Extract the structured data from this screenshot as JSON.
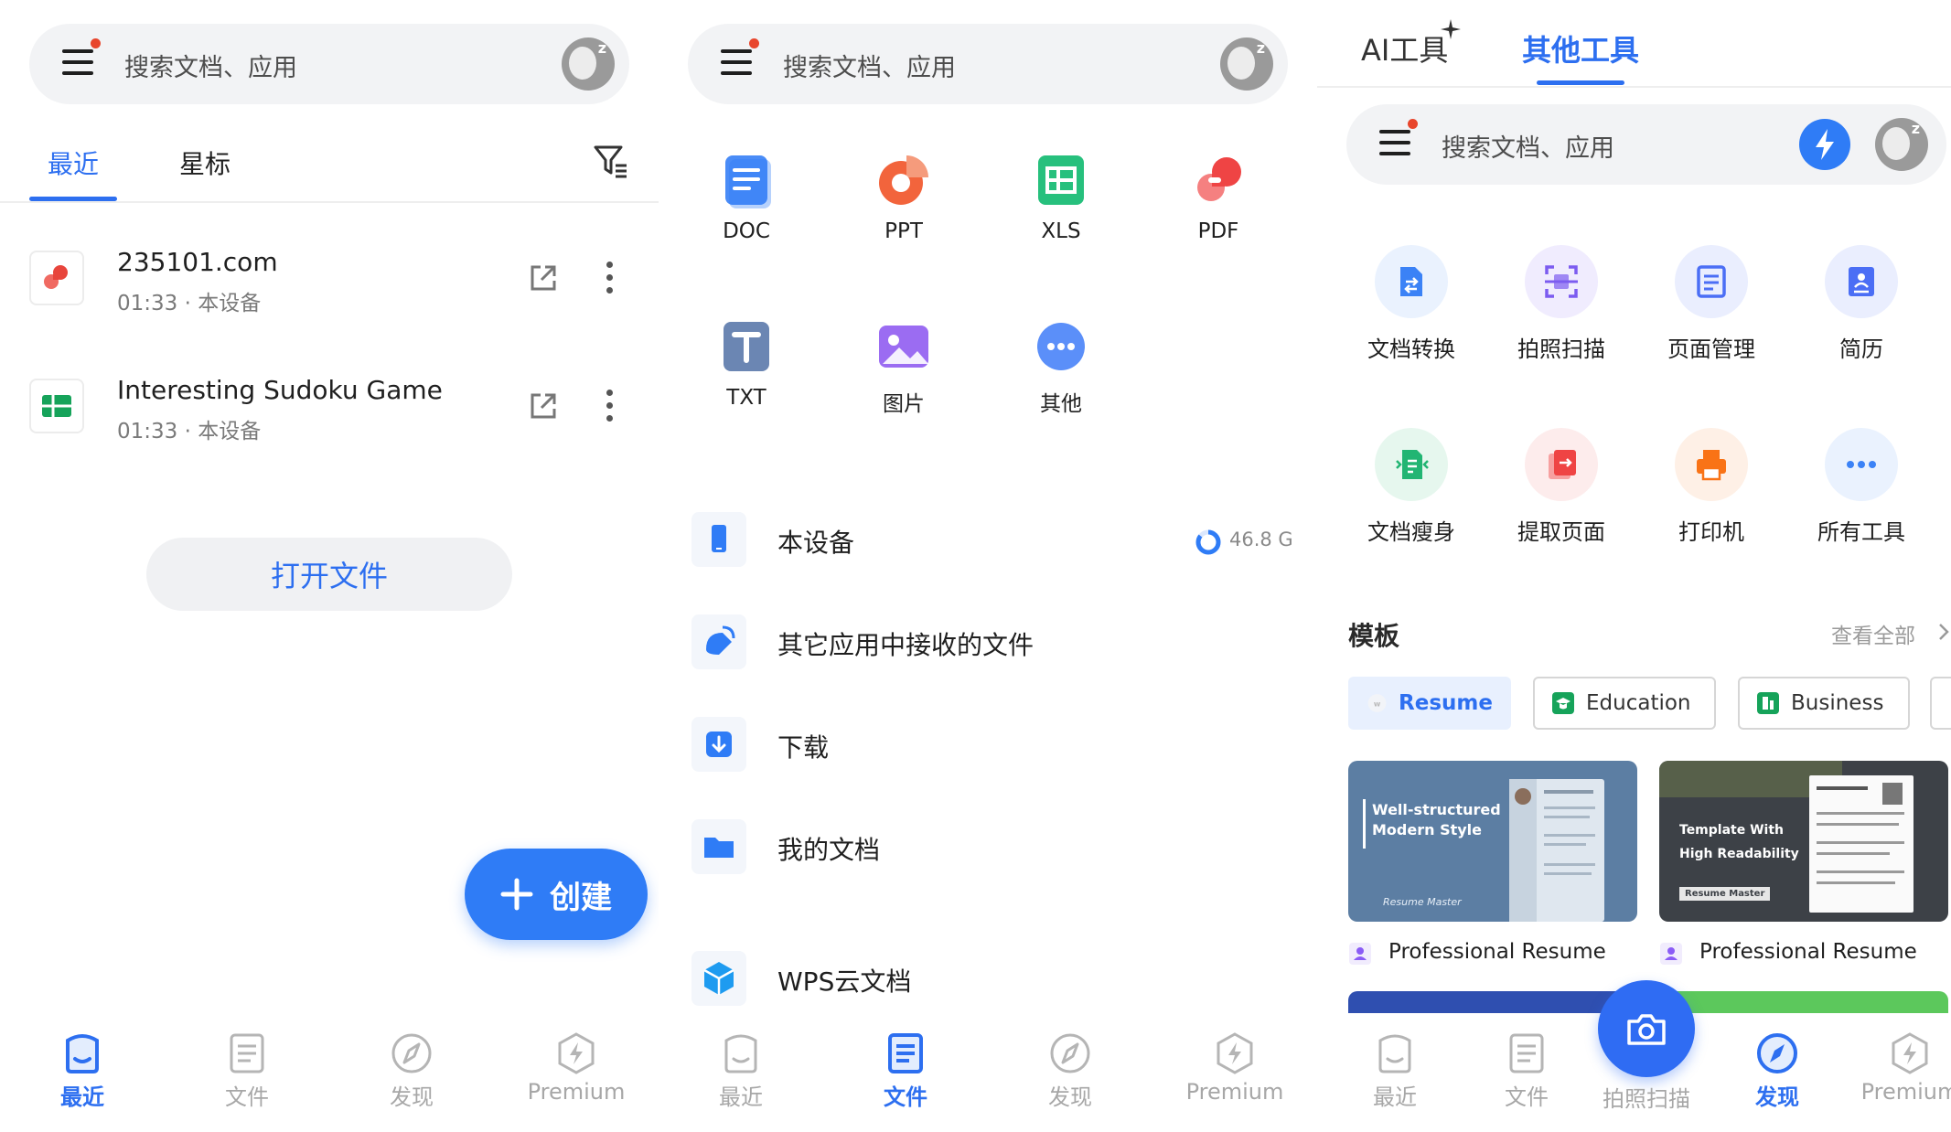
{
  "colors": {
    "accent": "#2d6ff0",
    "fab": "#2f7cf6",
    "notify_dot": "#e8452c",
    "inactive": "#a7a7a7"
  },
  "search": {
    "placeholder": "搜索文档、应用"
  },
  "bottom_nav": {
    "recent": "最近",
    "files": "文件",
    "discover": "发现",
    "premium": "Premium",
    "scan": "拍照扫描"
  },
  "recent_screen": {
    "tabs": {
      "recent": "最近",
      "starred": "星标"
    },
    "files": [
      {
        "name": "235101.com",
        "meta": "01:33 · 本设备",
        "icon": "pdf-icon"
      },
      {
        "name": "Interesting Sudoku Game",
        "meta": "01:33 · 本设备",
        "icon": "xls-icon"
      }
    ],
    "open_file_label": "打开文件",
    "create_label": "创建"
  },
  "files_screen": {
    "types": [
      {
        "label": "DOC",
        "icon": "doc-icon"
      },
      {
        "label": "PPT",
        "icon": "ppt-icon"
      },
      {
        "label": "XLS",
        "icon": "xls-icon"
      },
      {
        "label": "PDF",
        "icon": "pdf-icon"
      },
      {
        "label": "TXT",
        "icon": "txt-icon"
      },
      {
        "label": "图片",
        "icon": "image-icon"
      },
      {
        "label": "其他",
        "icon": "more-icon"
      }
    ],
    "locations": [
      {
        "label": "本设备",
        "icon": "phone-icon"
      },
      {
        "label": "其它应用中接收的文件",
        "icon": "received-icon"
      },
      {
        "label": "下载",
        "icon": "download-icon"
      },
      {
        "label": "我的文档",
        "icon": "folder-icon"
      },
      {
        "label": "WPS云文档",
        "icon": "cloud-cube-icon"
      }
    ],
    "storage_label": "46.8 G",
    "storage_used_fraction": 0.85
  },
  "discover_screen": {
    "tabs": {
      "ai_tools": "AI工具",
      "other_tools": "其他工具"
    },
    "tools": [
      {
        "label": "文档转换",
        "icon": "convert-icon",
        "color": "#3b82f6"
      },
      {
        "label": "拍照扫描",
        "icon": "scan-icon",
        "color": "#7c5cf0"
      },
      {
        "label": "页面管理",
        "icon": "page-manage-icon",
        "color": "#4b6ef5"
      },
      {
        "label": "简历",
        "icon": "resume-icon",
        "color": "#4b6ef5"
      },
      {
        "label": "文档瘦身",
        "icon": "slim-icon",
        "color": "#22b573"
      },
      {
        "label": "提取页面",
        "icon": "extract-icon",
        "color": "#ef4444"
      },
      {
        "label": "打印机",
        "icon": "printer-icon",
        "color": "#f97316"
      },
      {
        "label": "所有工具",
        "icon": "more-icon",
        "color": "#3b82f6"
      }
    ],
    "templates_title": "模板",
    "see_all": "查看全部",
    "chips": [
      {
        "label": "Resume",
        "active": true
      },
      {
        "label": "Education",
        "active": false
      },
      {
        "label": "Business",
        "active": false
      }
    ],
    "cards": [
      {
        "caption": "Professional Resume",
        "headline1": "Well-structured",
        "headline2": "Modern Style",
        "brand": "Resume Master"
      },
      {
        "caption": "Professional Resume",
        "headline1": "Template With",
        "headline2": "High Readability",
        "brand": "Resume Master"
      }
    ]
  }
}
